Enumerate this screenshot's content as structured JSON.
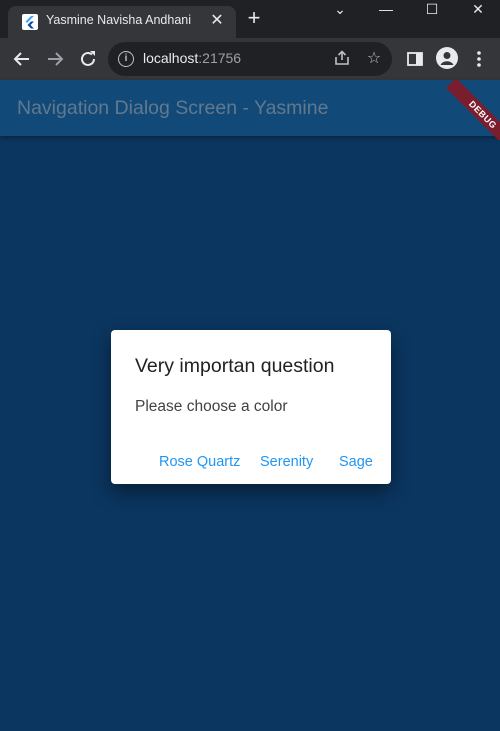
{
  "browser": {
    "tab_title": "Yasmine Navisha Andhani",
    "tab_close": "✕",
    "new_tab": "+",
    "url_host": "localhost",
    "url_port": ":21756",
    "controls": {
      "minimize": "—",
      "maximize": "☐",
      "close": "✕",
      "dropdown": "⌄"
    }
  },
  "app": {
    "title": "Navigation Dialog Screen - Yasmine",
    "debug_label": "DEBUG",
    "background_color": "#0b3660",
    "appbar_color": "#114a78"
  },
  "dialog": {
    "title": "Very importan question",
    "content": "Please choose a color",
    "actions": [
      "Rose Quartz",
      "Serenity",
      "Sage"
    ],
    "accent_color": "#2196f3"
  }
}
